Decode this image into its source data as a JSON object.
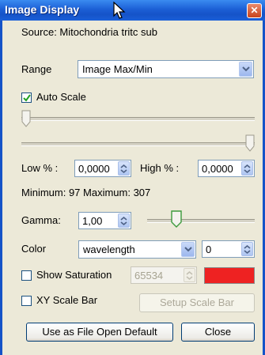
{
  "window": {
    "title": "Image Display",
    "close_glyph": "✕"
  },
  "source": {
    "label": "Source: Mitochondria tritc sub"
  },
  "range": {
    "label": "Range",
    "value": "Image Max/Min"
  },
  "auto_scale": {
    "label": "Auto Scale",
    "checked": true
  },
  "low": {
    "label": "Low % :",
    "value": "0,0000"
  },
  "high": {
    "label": "High % :",
    "value": "0,0000"
  },
  "minmax": {
    "text": "Minimum: 97 Maximum: 307"
  },
  "gamma": {
    "label": "Gamma:",
    "value": "1,00"
  },
  "color": {
    "label": "Color",
    "value": "wavelength",
    "number": "0"
  },
  "show_saturation": {
    "label": "Show Saturation",
    "checked": false,
    "value": "65534",
    "swatch_color": "#ee2222"
  },
  "xy_scale_bar": {
    "label": "XY Scale Bar",
    "checked": false,
    "setup_label": "Setup Scale Bar"
  },
  "buttons": {
    "default_label": "Use as File Open Default",
    "close_label": "Close"
  },
  "icons": {
    "dropdown": "chevron-down-icon",
    "spinner": "spinner-arrows-icon",
    "check": "checkmark-icon",
    "cursor": "mouse-cursor-icon"
  }
}
